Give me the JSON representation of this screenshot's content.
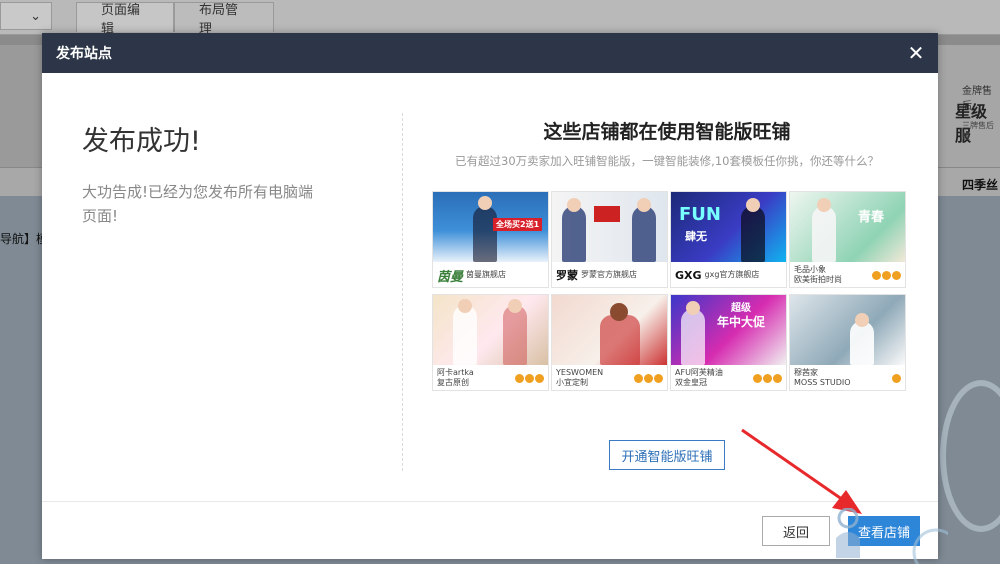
{
  "background": {
    "tabs": [
      "页面编辑",
      "布局管理"
    ],
    "banner_gold": "金牌售后",
    "banner_star": "星级服",
    "banner_small": "三牌售后服",
    "strip_text": "四季丝",
    "nav_fragment": "导航】模"
  },
  "modal": {
    "title": "发布站点",
    "success_title": "发布成功!",
    "success_desc": "大功告成!已经为您发布所有电脑端页面!",
    "right_title": "这些店铺都在使用智能版旺铺",
    "right_subtitle": "已有超过30万卖家加入旺铺智能版，一键智能装修,10套模板任你挑，你还等什么？",
    "stores": [
      {
        "logo": "茵曼",
        "name": "茵曼旗舰店"
      },
      {
        "logo": "罗蒙",
        "name": "罗蒙官方旗舰店"
      },
      {
        "logo": "GXG",
        "name": "gxg官方旗舰店"
      },
      {
        "logo": "",
        "name": "毛品小象",
        "name2": "欧美街拍时尚"
      },
      {
        "logo": "",
        "name": "阿卡artka",
        "name2": "复古原创"
      },
      {
        "logo": "",
        "name": "YESWOMEN",
        "name2": "小宜定制"
      },
      {
        "logo": "",
        "name": "AFU阿芙精油",
        "name2": "双金皇冠"
      },
      {
        "logo": "",
        "name": "穆茜家",
        "name2": "MOSS STUDIO"
      }
    ],
    "card_texts": {
      "c1_overlay": "全场买2送1",
      "c3_overlay": "FUN",
      "c3_sub": "肆无",
      "c4_overlay": "青春",
      "c7_overlay": "年中大促",
      "c7_top": "超级"
    },
    "open_button": "开通智能版旺铺",
    "back_button": "返回",
    "view_button": "查看店铺"
  },
  "colors": {
    "header_bg": "#2c3648",
    "primary": "#2e86d8",
    "arrow": "#e8292c"
  },
  "icons": {
    "close": "close-icon"
  }
}
